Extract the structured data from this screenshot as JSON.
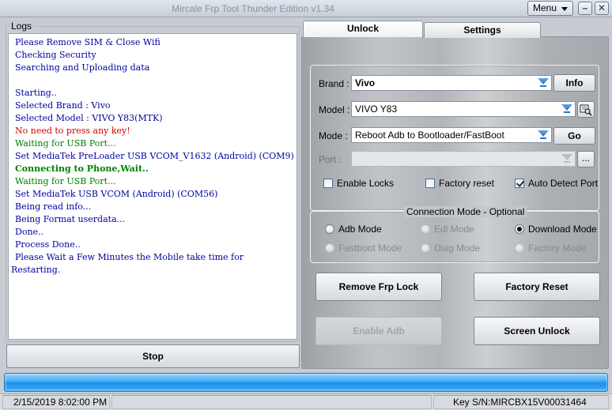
{
  "window": {
    "title": "Mircale Frp Tool Thunder Edition v1.34",
    "menu_label": "Menu",
    "minimize_glyph": "–",
    "close_glyph": "✕"
  },
  "logs": {
    "legend": "Logs",
    "lines": [
      {
        "text": "Please Remove SIM & Close Wifi",
        "color": "#0000a0",
        "bold": false
      },
      {
        "text": "Checking Security",
        "color": "#0000a0",
        "bold": false
      },
      {
        "text": "Searching and Uploading data",
        "color": "#0000a0",
        "bold": false
      },
      {
        "text": "",
        "color": "#0000a0",
        "bold": false
      },
      {
        "text": "Starting..",
        "color": "#0000a0",
        "bold": false
      },
      {
        "text": "Selected Brand : Vivo",
        "color": "#0000a0",
        "bold": false
      },
      {
        "text": "Selected Model : VIVO Y83(MTK)",
        "color": "#0000a0",
        "bold": false
      },
      {
        "text": "No need to press any key!",
        "color": "#d00000",
        "bold": false
      },
      {
        "text": "Waiting for USB Port...",
        "color": "#008000",
        "bold": false
      },
      {
        "text": "Set MediaTek PreLoader USB VCOM_V1632 (Android) (COM9)",
        "color": "#0000a0",
        "bold": false
      },
      {
        "text": "Connecting to Phone,Wait..",
        "color": "#008000",
        "bold": true
      },
      {
        "text": "Waiting for USB Port...",
        "color": "#008000",
        "bold": false
      },
      {
        "text": "Set MediaTek USB VCOM (Android) (COM56)",
        "color": "#0000a0",
        "bold": false
      },
      {
        "text": "Being read info...",
        "color": "#0000a0",
        "bold": false
      },
      {
        "text": "Being Format userdata...",
        "color": "#0000a0",
        "bold": false
      },
      {
        "text": "Done..",
        "color": "#0000a0",
        "bold": false
      },
      {
        "text": "Process Done..",
        "color": "#0000a0",
        "bold": false
      },
      {
        "text": "Please Wait a Few Minutes the Mobile take time for Restarting.",
        "color": "#0000a0",
        "bold": false,
        "wrap": true
      }
    ]
  },
  "stop_label": "Stop",
  "tabs": {
    "unlock": "Unlock",
    "settings": "Settings"
  },
  "form": {
    "brand_label": "Brand :",
    "brand_value": "Vivo",
    "info_label": "Info",
    "model_label": "Model :",
    "model_value": "VIVO Y83",
    "mode_label": "Mode :",
    "mode_value": "Reboot Adb to Bootloader/FastBoot",
    "go_label": "Go",
    "port_label": "Port :",
    "port_value": "",
    "port_browse": "...",
    "enable_locks": {
      "label": "Enable Locks",
      "checked": false
    },
    "factory_reset_chk": {
      "label": "Factory reset",
      "checked": false
    },
    "auto_detect": {
      "label": "Auto Detect Port",
      "checked": true
    }
  },
  "connection": {
    "legend": "Connection Mode - Optional",
    "adb": {
      "label": "Adb Mode",
      "selected": false,
      "enabled": true
    },
    "edl": {
      "label": "Edl Mode",
      "selected": false,
      "enabled": false
    },
    "download": {
      "label": "Download Mode",
      "selected": true,
      "enabled": true
    },
    "fastboot": {
      "label": "Fastboot Mode",
      "selected": false,
      "enabled": false
    },
    "diag": {
      "label": "Diag Mode",
      "selected": false,
      "enabled": false
    },
    "factory": {
      "label": "Factory Mode",
      "selected": false,
      "enabled": false
    }
  },
  "actions": {
    "remove_frp": "Remove Frp Lock",
    "factory_reset": "Factory Reset",
    "enable_adb": "Enable Adb",
    "screen_unlock": "Screen Unlock"
  },
  "progress": {
    "percent": 100,
    "color": "#2a96ec"
  },
  "status": {
    "datetime": "2/15/2019 8:02:00 PM",
    "key_sn": "Key S/N:MIRCBX15V00031464"
  }
}
